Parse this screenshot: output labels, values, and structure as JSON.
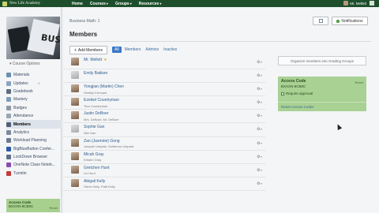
{
  "topnav": {
    "logo_text": "New Life Academy",
    "items": [
      {
        "label": "Home"
      },
      {
        "label": "Courses"
      },
      {
        "label": "Groups"
      },
      {
        "label": "Resources"
      }
    ],
    "user_label": "Mr. Mellett",
    "brand_color": "#1e4f2c"
  },
  "sidebar": {
    "course_options": "Course Options",
    "items": [
      {
        "label": "Materials",
        "icon": "materials-icon",
        "color": "#6a8fb3"
      },
      {
        "label": "Updates",
        "icon": "updates-icon",
        "color": "#8aa4c2",
        "badge": "4"
      },
      {
        "label": "Gradebook",
        "icon": "gradebook-icon",
        "color": "#5d6e80"
      },
      {
        "label": "Mastery",
        "icon": "mastery-icon",
        "color": "#7f9db8"
      },
      {
        "label": "Badges",
        "icon": "badges-icon",
        "color": "#8e98a4"
      },
      {
        "label": "Attendance",
        "icon": "attendance-icon",
        "color": "#9aa6b4"
      },
      {
        "label": "Members",
        "icon": "members-icon",
        "color": "#4d6077",
        "active": true
      },
      {
        "label": "Analytics",
        "icon": "analytics-icon",
        "color": "#7a8c9f"
      },
      {
        "label": "Workload Planning",
        "icon": "workload-icon",
        "color": "#6a7c90"
      },
      {
        "label": "BigBlueButton Confer...",
        "icon": "bigbluebutton-icon",
        "color": "#2b5aa8"
      },
      {
        "label": "LockDown Browser",
        "icon": "lockdown-icon",
        "color": "#5b6f88"
      },
      {
        "label": "OneNote Class Noteb...",
        "icon": "onenote-icon",
        "color": "#8a4bb0"
      },
      {
        "label": "Turnitin",
        "icon": "turnitin-icon",
        "color": "#c53a3a"
      }
    ],
    "access_code": {
      "title": "Access Code",
      "code": "BXXXN-8CB8C",
      "reset": "Reset"
    }
  },
  "main": {
    "breadcrumb": "Business Math: 1",
    "title": "Members",
    "view_label": "",
    "notifications_label": "Notifications",
    "add_members_label": "Add Members",
    "filters": [
      "All",
      "Members",
      "Admins",
      "Inactive"
    ],
    "members": [
      {
        "name": "Mr. Mellett",
        "sub": "",
        "star": true,
        "avatar": "photo"
      },
      {
        "name": "Emily Bakken",
        "sub": "",
        "avatar": "gray"
      },
      {
        "name": "Yongjian (Martin) Chen",
        "sub": "Shelley Kerrsant",
        "avatar": "photo"
      },
      {
        "name": "Ezekiel Countryman",
        "sub": "Tina Countryman",
        "avatar": "photo"
      },
      {
        "name": "Justin DeBoer",
        "sub": "Mrs. DeBoer, Mr. DeBoer",
        "avatar": "photo"
      },
      {
        "name": "Sophie Gan",
        "sub": "Wei Gan",
        "avatar": "gray"
      },
      {
        "name": "Zan (Jasmine) Gong",
        "sub": "Jacquie Umpala, Guillermo Umpala",
        "avatar": "photo"
      },
      {
        "name": "Micah Gray",
        "sub": "Kristen Gray",
        "avatar": "photo"
      },
      {
        "name": "Gretchen Hunt",
        "sub": "Liz Hunt",
        "avatar": "photo"
      },
      {
        "name": "Abigail Kelly",
        "sub": "Steve Kelly, Patti Kelly",
        "avatar": "photo"
      }
    ],
    "gear_symbol": "⚙",
    "right": {
      "organize_label": "Organize members into Grading Groups",
      "access_title": "Access Code",
      "access_code": "BXXXN-8CB8C",
      "reset": "Reset",
      "require_approval": "Require approval",
      "reset_link": "Reset Access Codes"
    }
  }
}
